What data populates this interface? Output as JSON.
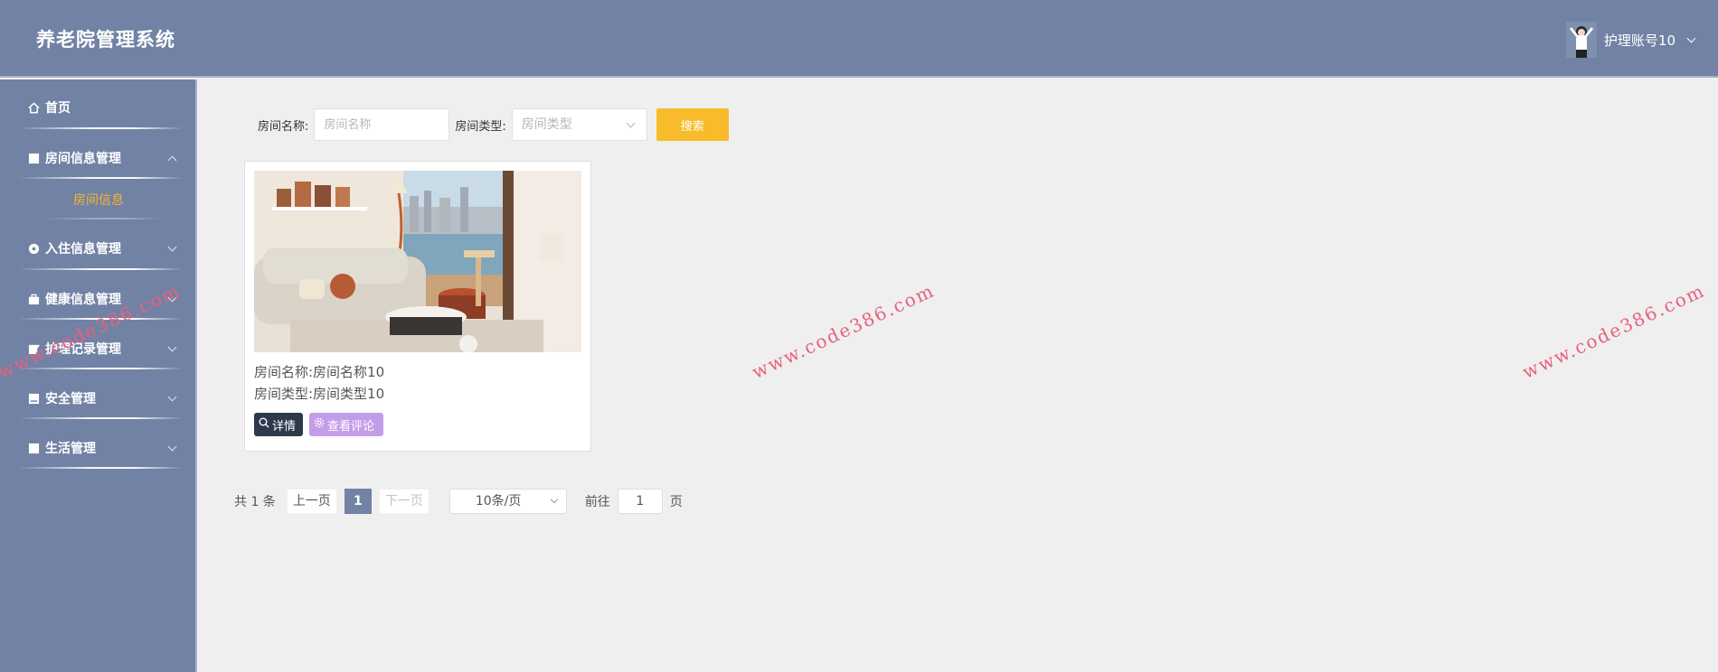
{
  "header": {
    "title": "养老院管理系统",
    "username": "护理账号10"
  },
  "sidebar": {
    "items": [
      {
        "label": "首页",
        "icon": "home-icon"
      },
      {
        "label": "房间信息管理",
        "icon": "doc-icon",
        "expanded": true,
        "children": [
          {
            "label": "房间信息",
            "active": true
          }
        ]
      },
      {
        "label": "入住信息管理",
        "icon": "circle-icon"
      },
      {
        "label": "健康信息管理",
        "icon": "box-icon"
      },
      {
        "label": "护理记录管理",
        "icon": "edit-icon"
      },
      {
        "label": "安全管理",
        "icon": "doc-icon"
      },
      {
        "label": "生活管理",
        "icon": "doc-icon"
      }
    ]
  },
  "search": {
    "name_label": "房间名称:",
    "name_placeholder": "房间名称",
    "type_label": "房间类型:",
    "type_placeholder": "房间类型",
    "button": "搜索"
  },
  "cards": [
    {
      "name_line": "房间名称:房间名称10",
      "type_line": "房间类型:房间类型10",
      "detail_label": "详情",
      "comment_label": "查看评论"
    }
  ],
  "pagination": {
    "total": "共 1 条",
    "prev": "上一页",
    "current_page": "1",
    "next": "下一页",
    "page_size": "10条/页",
    "goto_label": "前往",
    "goto_value": "1",
    "page_suffix": "页"
  },
  "watermark": "www.code386.com",
  "colors": {
    "primary": "#7282a5",
    "accent": "#f8bc2b",
    "detail_btn": "#2c3a4b",
    "comment_btn": "#c39ee8",
    "watermark": "#e8607e"
  }
}
